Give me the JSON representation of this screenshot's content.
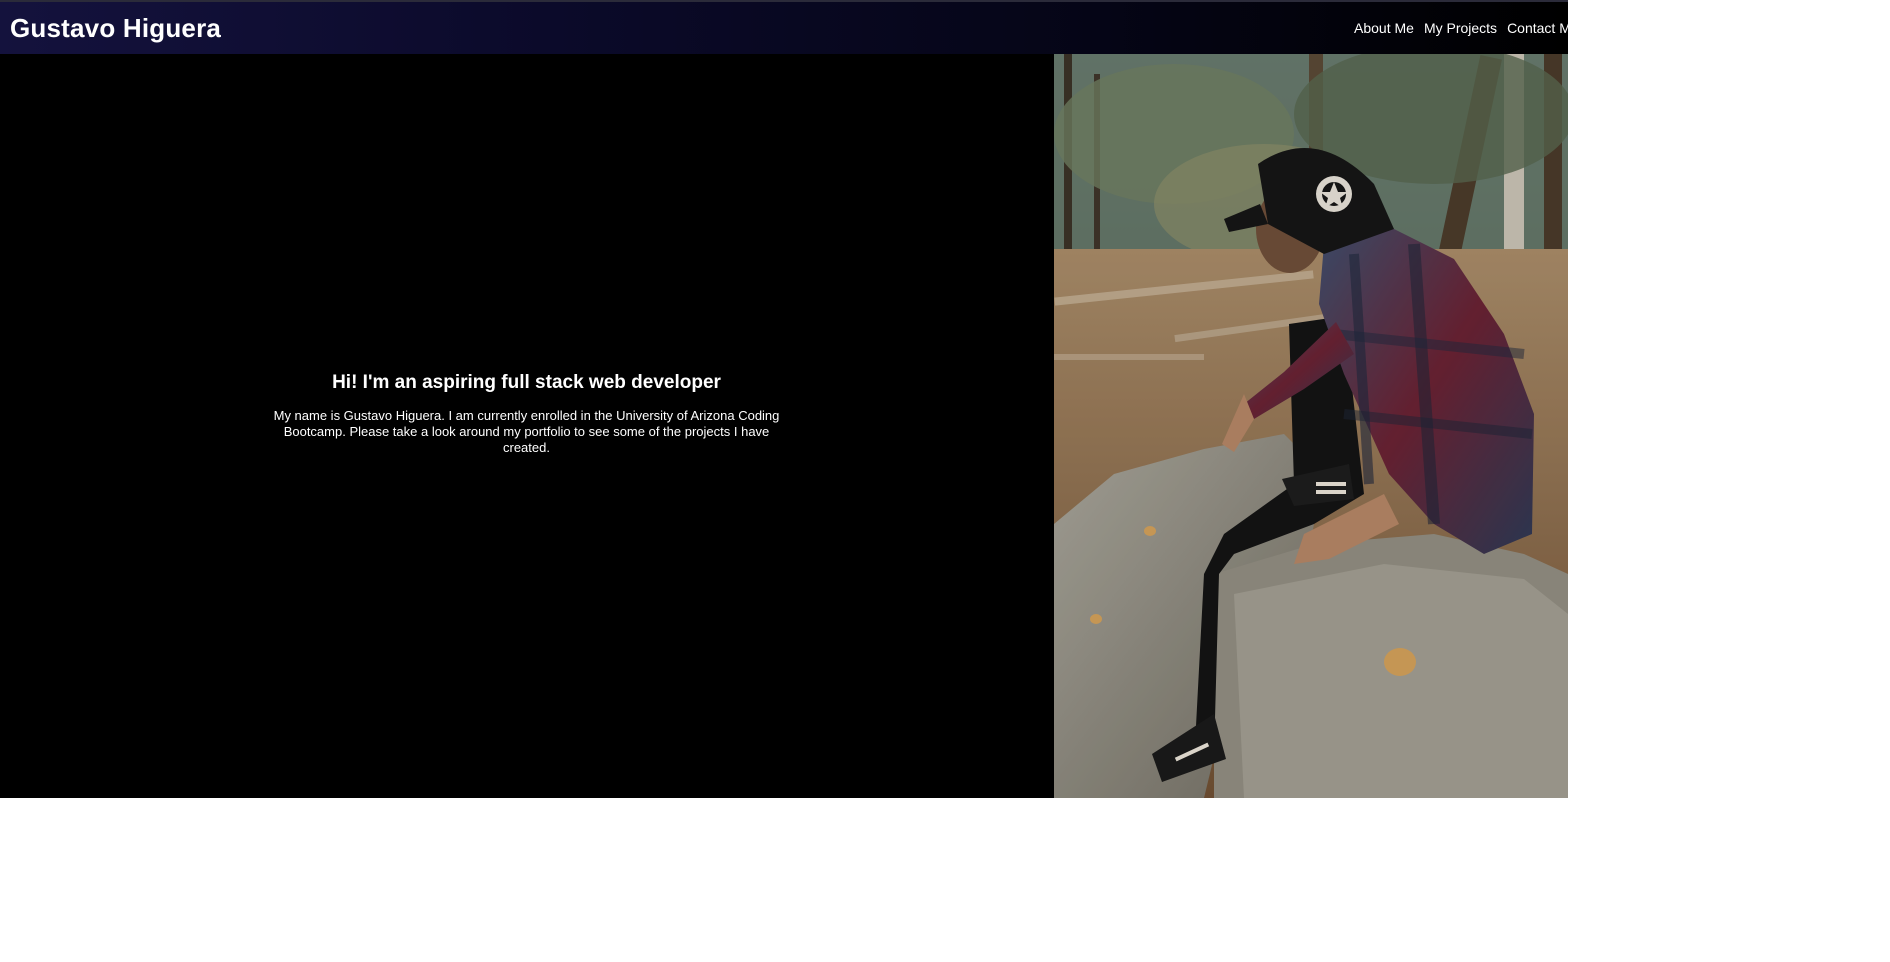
{
  "header": {
    "brand": "Gustavo Higuera",
    "nav": [
      {
        "label": "About Me"
      },
      {
        "label": "My Projects"
      },
      {
        "label": "Contact Me"
      }
    ]
  },
  "hero": {
    "heading": "Hi! I'm an aspiring full stack web developer",
    "body": "My name is Gustavo Higuera. I am currently enrolled in the University of Arizona Coding Bootcamp. Please take a look around my portfolio to see some of the projects I have created."
  },
  "colors": {
    "page_background": "#000000",
    "navbar_start": "#14123d",
    "navbar_end": "#000000",
    "text": "#ffffff"
  }
}
